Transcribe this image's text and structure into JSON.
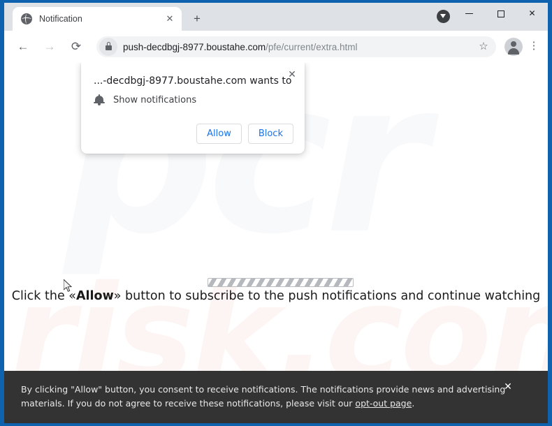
{
  "window": {
    "minimize_label": "Minimize",
    "maximize_label": "Maximize",
    "close_label": "✕",
    "download_icon": "download-arrow-icon"
  },
  "tab": {
    "title": "Notification",
    "favicon": "globe-icon",
    "close_label": "✕",
    "newtab_label": "+"
  },
  "toolbar": {
    "back_label": "←",
    "forward_label": "→",
    "reload_label": "⟳",
    "lock_icon": "lock-icon",
    "url_host": "push-decdbgj-8977.boustahe.com",
    "url_path": "/pfe/current/extra.html",
    "star_label": "☆",
    "profile_icon": "user-avatar-icon",
    "menu_label": "⋮"
  },
  "permission_dialog": {
    "title": "...-decdbgj-8977.boustahe.com wants to",
    "permission_icon": "bell-icon",
    "permission_label": "Show notifications",
    "allow_label": "Allow",
    "block_label": "Block",
    "close_label": "✕"
  },
  "page": {
    "watermark_top": "pcr",
    "watermark_bottom": "risk.com",
    "instruction_before": "Click the «",
    "instruction_bold": "Allow",
    "instruction_after": "» button to subscribe to the push notifications and continue watching",
    "progress_label": "loading-progress-bar",
    "cursor_label": "mouse-cursor"
  },
  "consent_banner": {
    "text_part1": "By clicking \"Allow\" button, you consent to receive notifications. The notifications provide news and advertising materials. If you do not agree to receive these notifications, please visit our ",
    "link_label": "opt-out page",
    "text_part2": ".",
    "close_label": "✕"
  },
  "colors": {
    "accent_blue": "#1a73e8",
    "window_border": "#0f63ae",
    "banner_bg": "#333333",
    "tabstrip_bg": "#dee1e6"
  }
}
